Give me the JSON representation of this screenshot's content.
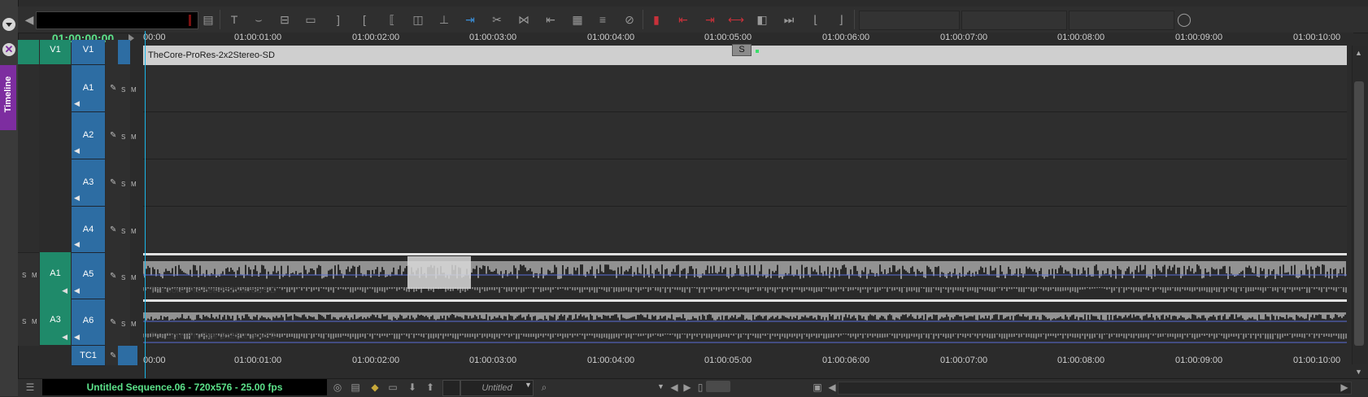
{
  "panel": {
    "tab_label": "Timeline"
  },
  "master_timecode": "01:00:00:00",
  "ruler_ticks": [
    "00:00",
    "1:00:01:00",
    "1:00:02:00",
    "1:00:03:00",
    "1:00:04:00",
    "1:00:05:00",
    "1:00:06:00",
    "1:00:07:00",
    "1:00:08:00",
    "1:00:09:00",
    "1:00:10:00"
  ],
  "ruler_tick_labels_full": [
    "00:00",
    "01:00:01:00",
    "01:00:02:00",
    "01:00:03:00",
    "01:00:04:00",
    "01:00:05:00",
    "01:00:06:00",
    "01:00:07:00",
    "01:00:08:00",
    "01:00:09:00",
    "01:00:10:00"
  ],
  "source_tracks": [
    {
      "label": "V1"
    },
    {
      "label": "A1"
    },
    {
      "label": "A3"
    }
  ],
  "record_tracks": [
    {
      "label": "V1"
    },
    {
      "label": "A1"
    },
    {
      "label": "A2"
    },
    {
      "label": "A3"
    },
    {
      "label": "A4"
    },
    {
      "label": "A5"
    },
    {
      "label": "A6"
    },
    {
      "label": "TC1"
    }
  ],
  "track_controls": {
    "solo": "S",
    "mute": "M"
  },
  "clip_name": "TheCore-ProRes-2x2Stereo-SD",
  "marker_label": "S",
  "status": {
    "sequence_info": "Untitled Sequence.06 - 720x576 - 25.00 fps",
    "bin_name": "Untitled"
  },
  "colors": {
    "timecode_green": "#5ce28a",
    "video_source": "#1f8a6a",
    "record_track": "#2d6da3",
    "playhead": "#19b6e8",
    "tab_purple": "#7d2da0",
    "waveform": "#d8d8d8",
    "waveform_line": "#5a6fd8"
  }
}
